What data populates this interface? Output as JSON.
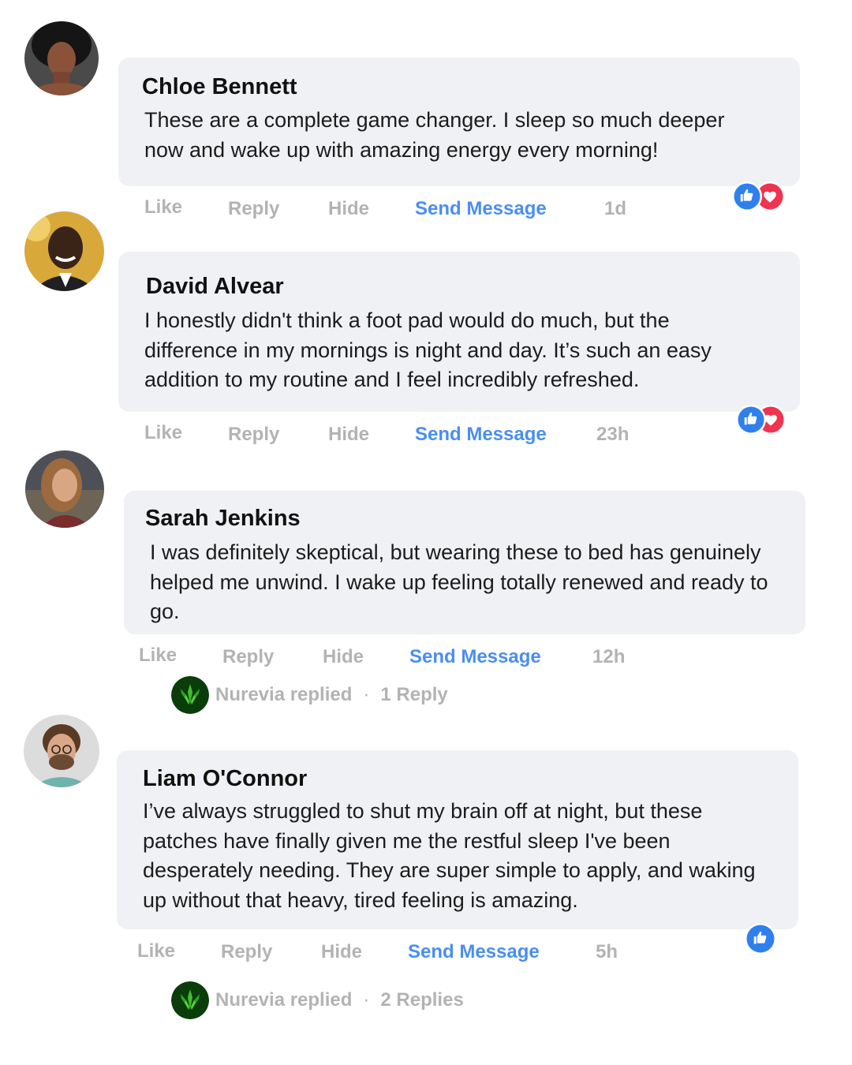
{
  "comments": [
    {
      "author": "Chloe Bennett",
      "text": "These are a complete game changer. I sleep so much deeper now and wake up with amazing energy every morning!",
      "actions": {
        "like": "Like",
        "reply": "Reply",
        "hide": "Hide",
        "send_message": "Send Message",
        "time": "1d"
      },
      "reactions": [
        "like-icon",
        "love-icon"
      ]
    },
    {
      "author": "David Alvear",
      "text": "I honestly didn't think a foot pad would do much, but the difference in my mornings is night and day. It’s such an easy addition to my routine and I feel incredibly refreshed.",
      "actions": {
        "like": "Like",
        "reply": "Reply",
        "hide": "Hide",
        "send_message": "Send Message",
        "time": "23h"
      },
      "reactions": [
        "like-icon",
        "love-icon"
      ]
    },
    {
      "author": "Sarah Jenkins",
      "text": "I was definitely skeptical, but wearing these to bed has genuinely helped me unwind. I wake up feeling totally renewed and ready to go.",
      "actions": {
        "like": "Like",
        "reply": "Reply",
        "hide": "Hide",
        "send_message": "Send Message",
        "time": "12h"
      },
      "replied": {
        "text": "Nurevia replied",
        "separator": "·",
        "count": "1 Reply"
      }
    },
    {
      "author": "Liam O'Connor",
      "text": "I’ve always struggled to shut my brain off at night, but these patches have finally given me the restful sleep I've been desperately needing. They are super simple to apply, and waking up without that heavy, tired feeling is amazing.",
      "actions": {
        "like": "Like",
        "reply": "Reply",
        "hide": "Hide",
        "send_message": "Send Message",
        "time": "5h"
      },
      "reactions": [
        "like-icon"
      ],
      "replied": {
        "text": "Nurevia replied",
        "separator": "·",
        "count": "2 Replies"
      }
    }
  ],
  "colors": {
    "accent": "#4a8ef0",
    "bubble": "#eff1f4",
    "muted": "#b3b3b3",
    "like_blue": "#2f80ed",
    "love_red": "#f0334f"
  }
}
